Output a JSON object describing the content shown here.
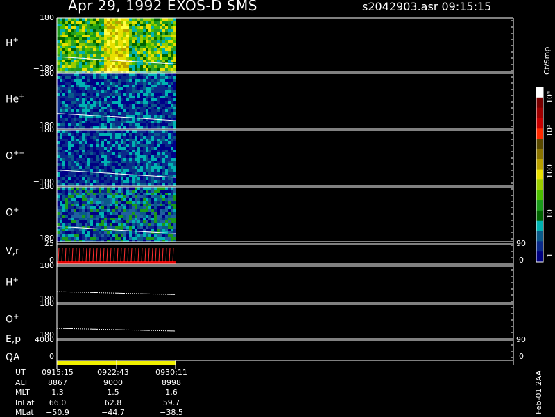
{
  "header": {
    "title": "Apr 29, 1992    EXOS-D SMS",
    "file": "s2042903.asr  09:15:15"
  },
  "panels": [
    {
      "id": "h_plus",
      "label": "H",
      "sup": "+",
      "ytop": "180",
      "ybot": "−180"
    },
    {
      "id": "he_plus",
      "label": "He",
      "sup": "+",
      "ytop": "180",
      "ybot": "−180"
    },
    {
      "id": "o_pp",
      "label": "O",
      "sup": "++",
      "ytop": "180",
      "ybot": "−180"
    },
    {
      "id": "o_plus",
      "label": "O",
      "sup": "+",
      "ytop": "180",
      "ybot": "−180"
    },
    {
      "id": "vr",
      "label": "V,r",
      "sup": "",
      "ytop": "25",
      "ybot": "0",
      "rtop": "90",
      "rbot": "0"
    },
    {
      "id": "h_plus2",
      "label": "H",
      "sup": "+",
      "ytop": "180",
      "ybot": "−180"
    },
    {
      "id": "o_plus2",
      "label": "O",
      "sup": "+",
      "ytop": "180",
      "ybot": "−180"
    },
    {
      "id": "ep",
      "label": "E,p",
      "sup": "",
      "ytop": "4000",
      "ybot": "0",
      "rtop": "90",
      "rbot": "0"
    },
    {
      "id": "qa",
      "label": "QA",
      "sup": "",
      "ytop": "",
      "ybot": ""
    }
  ],
  "colorbar": {
    "unit": "Ct/Smp",
    "ticks": [
      "10⁴",
      "10³",
      "100",
      "10",
      "1"
    ],
    "colors": [
      "#ffffff",
      "#7a0000",
      "#a00000",
      "#c80000",
      "#ff2a00",
      "#5a4a00",
      "#8a7400",
      "#b8a000",
      "#e8e000",
      "#9acd00",
      "#4cbe00",
      "#1a9a1a",
      "#006400",
      "#00b2b2",
      "#0a5a8a",
      "#0a2a8a",
      "#000080"
    ]
  },
  "timeline": {
    "footer_note": "Feb-01 2AA",
    "rows": [
      {
        "name": "UT",
        "values": [
          "0915:15",
          "0922:43",
          "0930:11"
        ]
      },
      {
        "name": "ALT",
        "values": [
          "8867",
          "9000",
          "8998"
        ]
      },
      {
        "name": "MLT",
        "values": [
          "1.3",
          "1.5",
          "1.6"
        ]
      },
      {
        "name": "InLat",
        "values": [
          "66.0",
          "62.8",
          "59.7"
        ]
      },
      {
        "name": "MLat",
        "values": [
          "−50.9",
          "−44.7",
          "−38.5"
        ]
      }
    ]
  },
  "chart_data": {
    "type": "heatmap",
    "title": "Apr 29, 1992    EXOS-D SMS",
    "x_ticks": [
      "0915:15",
      "0922:43",
      "0930:11"
    ],
    "colorbar_label": "Ct/Smp",
    "colorbar_range": [
      1,
      10000
    ],
    "colorbar_scale": "log",
    "ion_species": [
      "H+",
      "He+",
      "O++",
      "O+"
    ],
    "pitch_angle_range": [
      -180,
      180
    ],
    "vr_range": [
      0,
      25
    ],
    "ep_range": [
      0,
      4000
    ]
  }
}
